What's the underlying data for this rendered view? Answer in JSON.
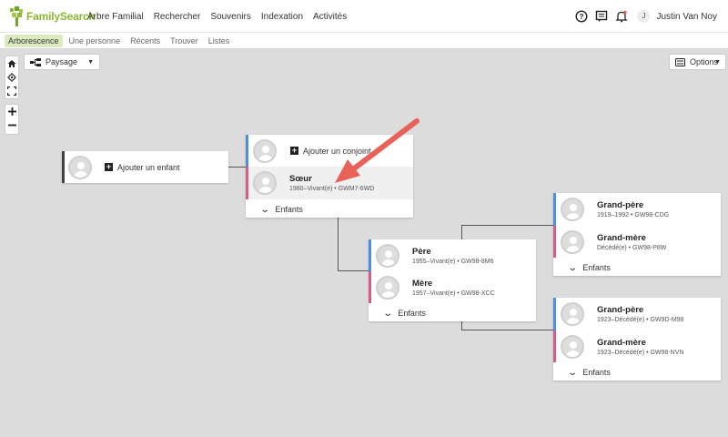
{
  "header": {
    "logo_text": "FamilySearch",
    "nav": [
      "Arbre Familial",
      "Rechercher",
      "Souvenirs",
      "Indexation",
      "Activités"
    ],
    "avatar_initial": "J",
    "user_name": "Justin Van Noy"
  },
  "subnav": [
    "Arborescence",
    "Une personne",
    "Récents",
    "Trouver",
    "Listes"
  ],
  "toolbar": {
    "layout_label": "Paysage",
    "options_label": "Options"
  },
  "tree": {
    "add_child": "Ajouter un enfant",
    "add_spouse": "Ajouter un conjoint",
    "focus": {
      "name": "Sœur",
      "meta": "1980–Vivant(e) • GWM7-6WD"
    },
    "father": {
      "name": "Père",
      "meta": "1955–Vivant(e) • GW98-8M6"
    },
    "mother": {
      "name": "Mère",
      "meta": "1957–Vivant(e) • GW98-XCC"
    },
    "pgf": {
      "name": "Grand-père",
      "meta": "1919–1992 • GW98-CDG"
    },
    "pgm": {
      "name": "Grand-mère",
      "meta": "Décédé(e) • GW98-P8W"
    },
    "mgf": {
      "name": "Grand-père",
      "meta": "1923–Décédé(e) • GW9D-M98"
    },
    "mgm": {
      "name": "Grand-mère",
      "meta": "1923–Décédé(e) • GW98-NVN"
    },
    "children_label": "Enfants"
  },
  "colors": {
    "male": "#4a8fe0",
    "female": "#d65b8a",
    "brand": "#8cb833",
    "arrow": "#e8625a"
  }
}
